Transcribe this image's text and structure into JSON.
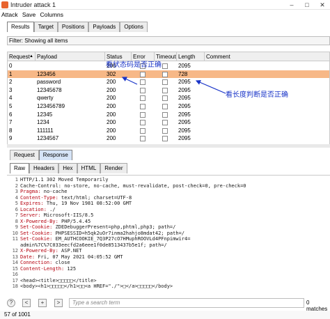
{
  "window": {
    "title": "Intruder attack 1",
    "minimize": "–",
    "maximize": "□",
    "close": "✕"
  },
  "menu": [
    "Attack",
    "Save",
    "Columns"
  ],
  "top_tabs": [
    {
      "label": "Results",
      "active": true
    },
    {
      "label": "Target",
      "active": false
    },
    {
      "label": "Positions",
      "active": false
    },
    {
      "label": "Payloads",
      "active": false
    },
    {
      "label": "Options",
      "active": false
    }
  ],
  "filter": {
    "text": "Filter: Showing all items"
  },
  "table": {
    "columns": [
      "Request",
      "Payload",
      "Status",
      "Error",
      "Timeout",
      "Length",
      "Comment"
    ],
    "sort_indicator": "▲",
    "rows": [
      {
        "request": "0",
        "payload": "",
        "status": "200",
        "length": "2095",
        "selected": false
      },
      {
        "request": "1",
        "payload": "123456",
        "status": "302",
        "length": "728",
        "selected": true
      },
      {
        "request": "2",
        "payload": "password",
        "status": "200",
        "length": "2095",
        "selected": false
      },
      {
        "request": "3",
        "payload": "12345678",
        "status": "200",
        "length": "2095",
        "selected": false
      },
      {
        "request": "4",
        "payload": "qwerty",
        "status": "200",
        "length": "2095",
        "selected": false
      },
      {
        "request": "5",
        "payload": "123456789",
        "status": "200",
        "length": "2095",
        "selected": false
      },
      {
        "request": "6",
        "payload": "12345",
        "status": "200",
        "length": "2095",
        "selected": false
      },
      {
        "request": "7",
        "payload": "1234",
        "status": "200",
        "length": "2095",
        "selected": false
      },
      {
        "request": "8",
        "payload": "111111",
        "status": "200",
        "length": "2095",
        "selected": false
      },
      {
        "request": "9",
        "payload": "1234567",
        "status": "200",
        "length": "2095",
        "selected": false
      }
    ]
  },
  "annotations": {
    "status_note": "看状态码是否正确",
    "length_note": "看长度判断是否正确",
    "arrow_color": "#1a35c8"
  },
  "req_resp_tabs": [
    {
      "label": "Request",
      "active": false
    },
    {
      "label": "Response",
      "active": true
    }
  ],
  "view_tabs": [
    {
      "label": "Raw",
      "active": true
    },
    {
      "label": "Headers",
      "active": false
    },
    {
      "label": "Hex",
      "active": false
    },
    {
      "label": "HTML",
      "active": false
    },
    {
      "label": "Render",
      "active": false
    }
  ],
  "response_lines": [
    {
      "n": "1",
      "key": "",
      "val": "HTTP/1.1 302 Moved Temporarily"
    },
    {
      "n": "2",
      "key": "",
      "val": "Cache-Control: no-store, no-cache, must-revalidate, post-check=0, pre-check=0"
    },
    {
      "n": "3",
      "key": "Pragma:",
      "val": " no-cache"
    },
    {
      "n": "4",
      "key": "Content-Type:",
      "val": " text/html; charset=UTF-8"
    },
    {
      "n": "5",
      "key": "Expires:",
      "val": " Thu, 19 Nov 1981 08:52:00 GMT"
    },
    {
      "n": "6",
      "key": "Location:",
      "val": " ./"
    },
    {
      "n": "7",
      "key": "Server:",
      "val": " Microsoft-IIS/8.5"
    },
    {
      "n": "8",
      "key": "X-Powered-By:",
      "val": " PHP/5.4.45"
    },
    {
      "n": "9",
      "key": "Set-Cookie:",
      "val": " ZDEDebuggerPresent=php,phtml,php3; path=/"
    },
    {
      "n": "10",
      "key": "Set-Cookie:",
      "val": " PHPSESSID=h5qk2uOr7inma2hahjo8mdat42; path=/"
    },
    {
      "n": "11",
      "key": "Set-Cookie:",
      "val": " EM_AUTHCOOKIE_7Q3P27cO7HMuphROOVLd4PFnpimwir4="
    },
    {
      "n": "",
      "key": "",
      "val": "admin%7C%7C033eecfd2a6eee1f0de8513437b5e1f; path=/"
    },
    {
      "n": "12",
      "key": "X-Powered-By:",
      "val": " ASP.NET"
    },
    {
      "n": "13",
      "key": "Date:",
      "val": " Fri, 07 May 2021 04:05:52 GMT"
    },
    {
      "n": "14",
      "key": "Connection:",
      "val": " close"
    },
    {
      "n": "15",
      "key": "Content-Length:",
      "val": " 125"
    },
    {
      "n": "16",
      "key": "",
      "val": ""
    },
    {
      "n": "17",
      "key": "",
      "val": "<head><title>□□□□□</title>"
    },
    {
      "n": "18",
      "key": "",
      "val": "<body><h1>□□□□□</h1>□□<a HREF=\"./\">□</a>□□□□□</body>"
    }
  ],
  "search": {
    "help": "?",
    "prev": "<",
    "add": "+",
    "next": ">",
    "placeholder": "Type a search term",
    "matches": "0 matches"
  },
  "status": {
    "text": "57 of 1001"
  }
}
